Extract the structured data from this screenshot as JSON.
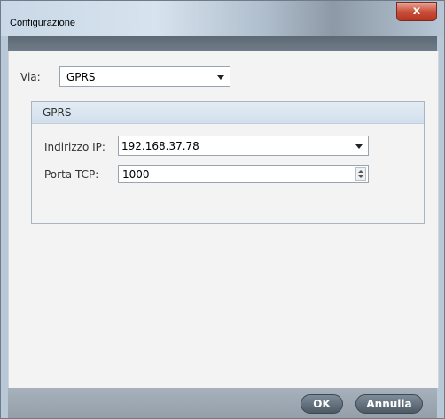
{
  "window": {
    "title": "Configurazione",
    "close_label": "x"
  },
  "via": {
    "label": "Via:",
    "selected": "GPRS"
  },
  "gprs_panel": {
    "title": "GPRS",
    "ip": {
      "label": "Indirizzo IP:",
      "value": "192.168.37.78"
    },
    "port": {
      "label": "Porta TCP:",
      "value": "1000"
    }
  },
  "footer": {
    "ok_label": "OK",
    "cancel_label": "Annulla"
  },
  "icons": [
    "close-icon",
    "chevron-down-icon",
    "spin-up-icon",
    "spin-down-icon"
  ]
}
